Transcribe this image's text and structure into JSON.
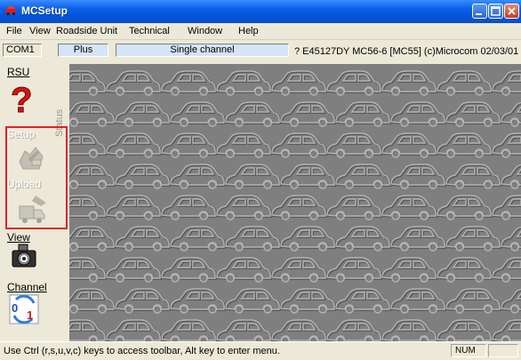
{
  "window": {
    "title": "MCSetup"
  },
  "menu": {
    "items": [
      "File",
      "View",
      "Roadside Unit",
      "Technical",
      "Window",
      "Help"
    ]
  },
  "status_fields": {
    "port": "COM1",
    "mode": "Plus",
    "channel_mode": "Single channel",
    "firmware": "? E45127DY MC56-6 [MC55] (c)Microcom 02/03/01"
  },
  "toolbar": {
    "rsu_label": "RSU",
    "status_label": "Status",
    "setup_label": "Setup",
    "upload_label": "Upload",
    "view_label": "View",
    "channel_label": "Channel"
  },
  "statusbar": {
    "message": "Use Ctrl (r,s,u,v,c) keys to access toolbar, Alt key to enter menu.",
    "num": "NUM"
  },
  "colors": {
    "titlebar": "#0a5ee6",
    "highlight": "#e4202a",
    "canvas": "#7f7f7f"
  }
}
